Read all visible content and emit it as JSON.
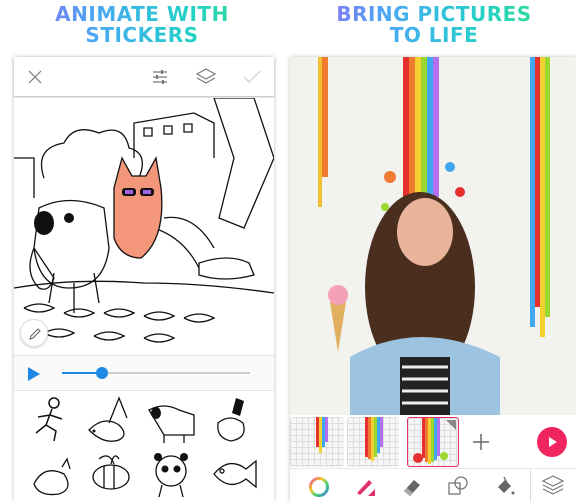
{
  "left": {
    "headline": [
      "ANIMATE WITH",
      "STICKERS"
    ],
    "toolbar": {
      "icons": [
        "close-icon",
        "sliders-icon",
        "layers-icon",
        "check-icon"
      ]
    },
    "timeline": {
      "progress": 0.2
    },
    "stickers": [
      "running-man",
      "bird",
      "dog",
      "bomb",
      "cat",
      "bee",
      "panda",
      "fish"
    ]
  },
  "right": {
    "headline": [
      "BRING PICTURES",
      "TO LIFE"
    ],
    "frames": {
      "count": 3,
      "selected": 3
    },
    "tools": [
      "color-wheel-icon",
      "brush-icon",
      "eraser-icon",
      "shapes-icon",
      "fill-bucket-icon",
      "layers-icon"
    ],
    "colors": {
      "accent": "#f0245f",
      "selected_tool": "#e0306a"
    }
  }
}
